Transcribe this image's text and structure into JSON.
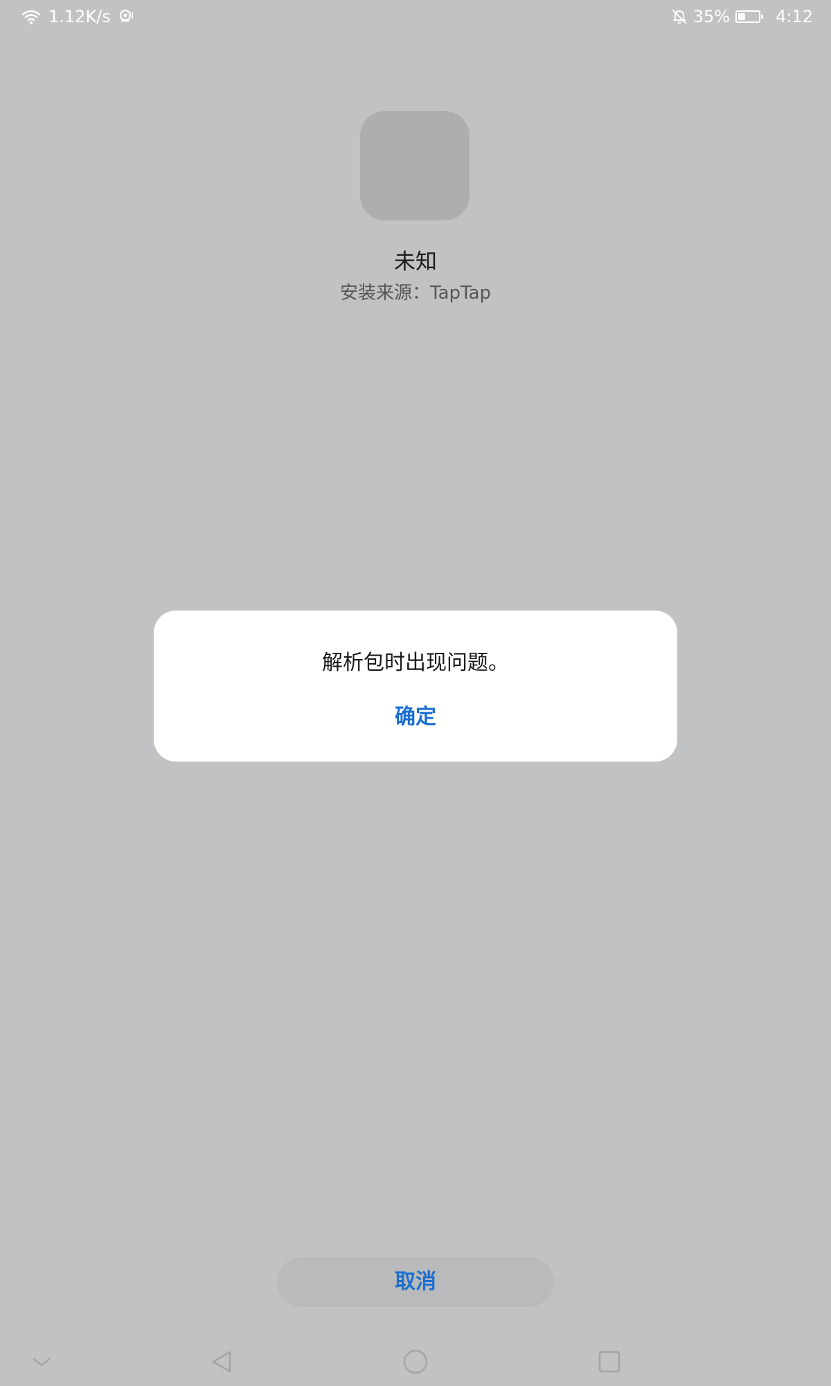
{
  "status_bar": {
    "net_speed": "1.12K/s",
    "battery_percent": "35%",
    "battery_level": 0.35,
    "time": "4:12",
    "icons": [
      "wifi-icon",
      "eye-comfort-icon",
      "notifications-off-icon",
      "battery-icon"
    ]
  },
  "app": {
    "name": "未知",
    "install_source": "安装来源：TapTap"
  },
  "dialog": {
    "message": "解析包时出现问题。",
    "ok_label": "确定"
  },
  "footer": {
    "cancel_label": "取消"
  },
  "nav": {
    "icons": [
      "chevron-down-icon",
      "back-icon",
      "home-icon",
      "recents-icon"
    ]
  },
  "colors": {
    "background": "#c1c2c4",
    "accent": "#1a6fd1",
    "dialog": "#ffffff"
  }
}
